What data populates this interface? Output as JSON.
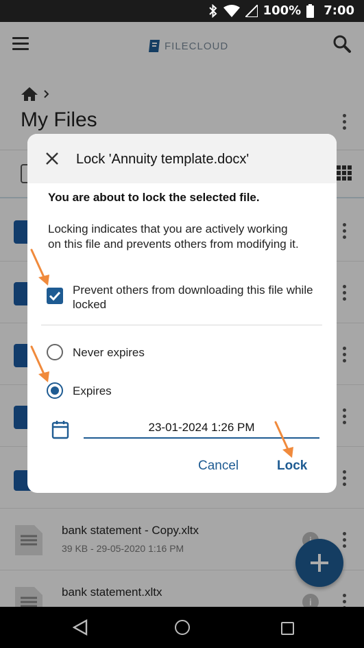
{
  "status_bar": {
    "battery": "100%",
    "time": "7:00"
  },
  "app_bar": {
    "logo_text": "FILECLOUD"
  },
  "page": {
    "title": "My Files"
  },
  "files": [
    {
      "name": "bank statement - Copy.xltx",
      "meta": "39 KB - 29-05-2020 1:16 PM"
    },
    {
      "name": "bank statement.xltx",
      "meta": ""
    }
  ],
  "dialog": {
    "title": "Lock 'Annuity template.docx'",
    "lead": "You are about to lock the selected file.",
    "body": "Locking indicates that you are actively working on this file and prevents others from modifying it.",
    "checkbox_label": "Prevent others from downloading this file while locked",
    "checkbox_checked": true,
    "radio_never": "Never expires",
    "radio_expires": "Expires",
    "selected_radio": "Expires",
    "date_value": "23-01-2024 1:26 PM",
    "cancel_label": "Cancel",
    "lock_label": "Lock"
  },
  "colors": {
    "accent": "#1e5b92",
    "arrow": "#f08a3c"
  }
}
